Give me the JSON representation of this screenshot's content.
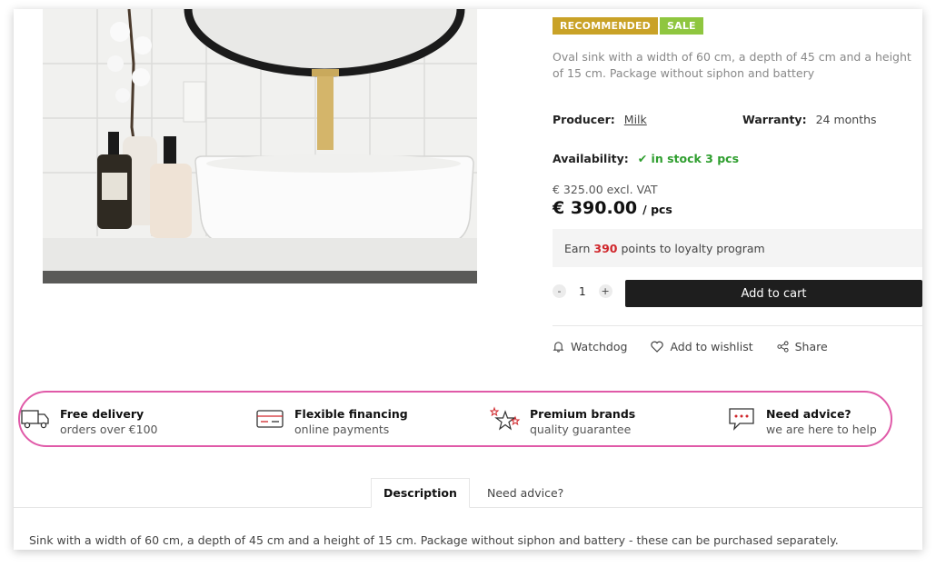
{
  "badges": {
    "recommended": "RECOMMENDED",
    "sale": "SALE"
  },
  "product": {
    "short_description": "Oval sink with a width of 60 cm, a depth of 45 cm and a height of 15 cm. Package without siphon and battery",
    "producer_label": "Producer:",
    "producer_value": "Milk",
    "warranty_label": "Warranty:",
    "warranty_value": "24 months",
    "availability_label": "Availability:",
    "availability_value": "✔ in stock 3 pcs",
    "price_excl": "€ 325.00 excl. VAT",
    "price": "€ 390.00",
    "price_unit": "/ pcs"
  },
  "loyalty": {
    "prefix": "Earn",
    "points": "390",
    "suffix": "points to loyalty program"
  },
  "quantity": {
    "minus": "-",
    "value": "1",
    "plus": "+"
  },
  "cart": {
    "label": "Add to cart"
  },
  "actions": {
    "watchdog": "Watchdog",
    "wishlist": "Add to wishlist",
    "share": "Share"
  },
  "features": [
    {
      "icon": "truck-icon",
      "title": "Free delivery",
      "subtitle": "orders over €100"
    },
    {
      "icon": "card-icon",
      "title": "Flexible financing",
      "subtitle": "online payments"
    },
    {
      "icon": "stars-icon",
      "title": "Premium brands",
      "subtitle": "quality guarantee"
    },
    {
      "icon": "chat-icon",
      "title": "Need advice?",
      "subtitle": "we are here to help"
    }
  ],
  "tabs": {
    "description": "Description",
    "advice": "Need advice?"
  },
  "description_text": "Sink with a width of 60 cm, a depth of 45 cm and a height of 15 cm. Package without siphon and battery - these can be purchased separately.",
  "colors": {
    "recommended": "#c9a227",
    "sale": "#8fc63f",
    "in_stock": "#2e9e2e",
    "points": "#d0262b",
    "feature_border": "#e05aa8",
    "cart": "#1e1e1e"
  }
}
